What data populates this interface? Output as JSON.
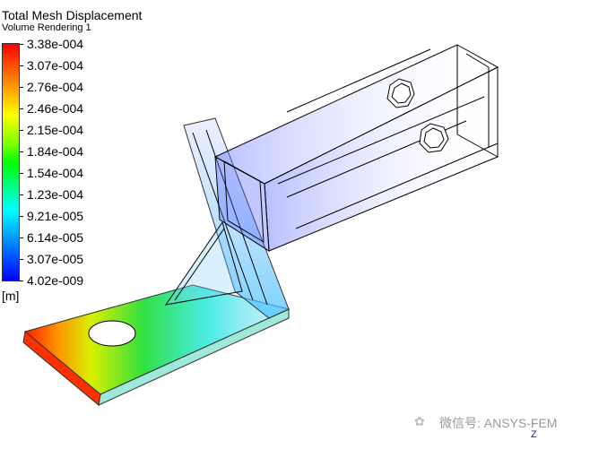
{
  "legend": {
    "title": "Total Mesh Displacement",
    "subtitle": "Volume Rendering 1",
    "unit": "[m]",
    "labels": [
      "3.38e-004",
      "3.07e-004",
      "2.76e-004",
      "2.46e-004",
      "2.15e-004",
      "1.84e-004",
      "1.54e-004",
      "1.23e-004",
      "9.21e-005",
      "6.14e-005",
      "3.07e-005",
      "4.02e-009"
    ],
    "colormap": [
      "#ff0000",
      "#ff8000",
      "#ffff00",
      "#00ff00",
      "#00ffff",
      "#0000ff"
    ]
  },
  "watermark": {
    "icon": "wechat-icon",
    "text": "微信号: ANSYS-FEM"
  },
  "axis_triad": {
    "z_label": "Z"
  }
}
